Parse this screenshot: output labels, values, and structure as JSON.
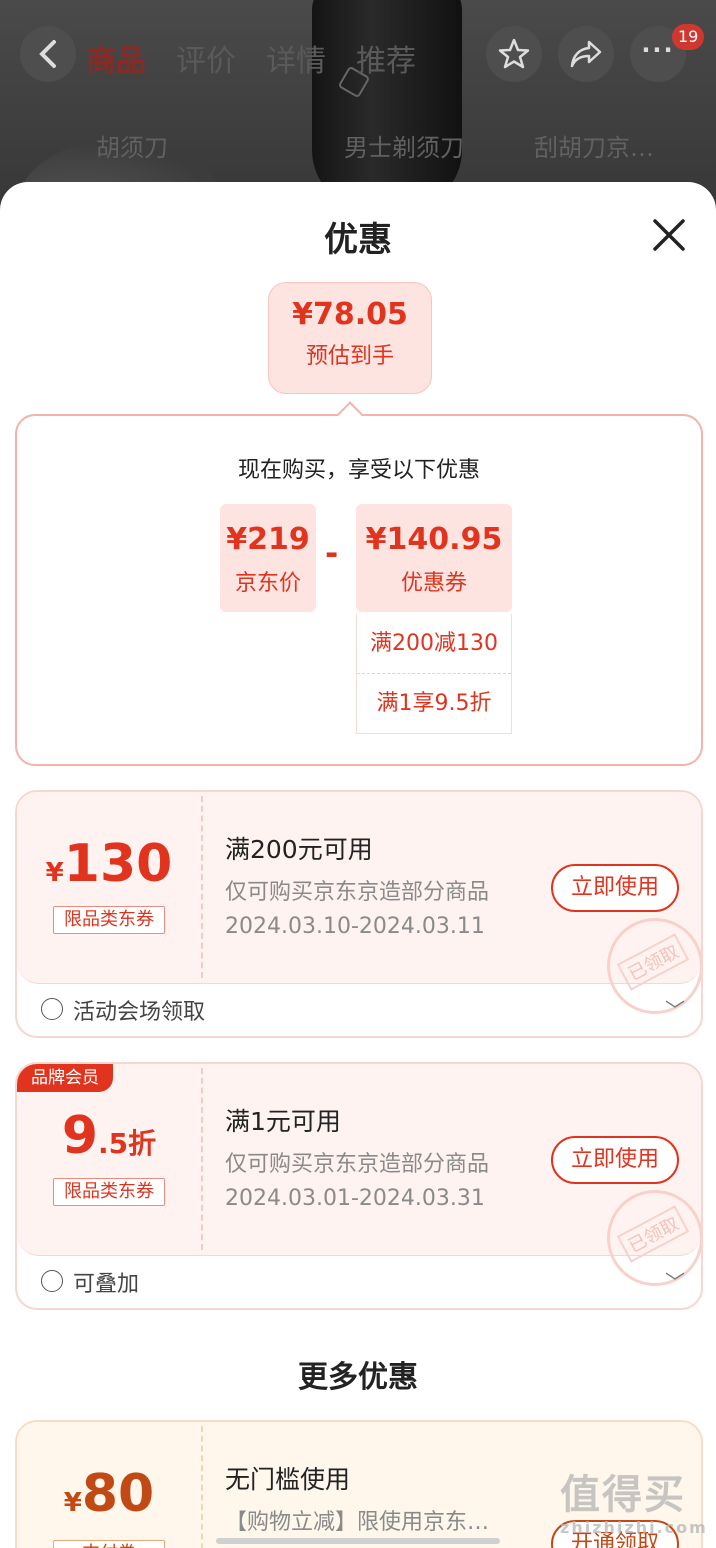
{
  "background": {
    "tabs": [
      "商品",
      "评价",
      "详情",
      "推荐"
    ],
    "search_chips": [
      "胡须刀",
      "男士剃须刀",
      "刮胡刀京…"
    ],
    "cart_badge": "19"
  },
  "sheet": {
    "title": "优惠",
    "estimate": {
      "price": "¥78.05",
      "label": "预估到手"
    },
    "breakdown": {
      "title": "现在购买，享受以下优惠",
      "jd_price": {
        "price": "¥219",
        "label": "京东价"
      },
      "minus": "-",
      "coupon_total": {
        "price": "¥140.95",
        "label": "优惠券"
      },
      "rules": [
        "满200减130",
        "满1享9.5折"
      ]
    },
    "coupons": [
      {
        "yen": "¥",
        "amount": "130",
        "suffix": "",
        "tag": "限品类东券",
        "condition": "满200元可用",
        "scope": "仅可购买京东京造部分商品",
        "date": "2024.03.10-2024.03.11",
        "action": "立即使用",
        "stamp": "已领取",
        "footer": "活动会场领取"
      },
      {
        "badge": "品牌会员",
        "yen": "",
        "amount": "9",
        "suffix": ".5折",
        "tag": "限品类东券",
        "condition": "满1元可用",
        "scope": "仅可购买京东京造部分商品",
        "date": "2024.03.01-2024.03.31",
        "action": "立即使用",
        "stamp": "已领取",
        "footer": "可叠加"
      }
    ],
    "more_title": "更多优惠",
    "more_coupons": [
      {
        "yen": "¥",
        "amount": "80",
        "tag": "支付券",
        "condition": "无门槛使用",
        "scope": "【购物立减】限使用京东…",
        "action": "开通领取"
      }
    ]
  },
  "watermark": {
    "main": "值得买",
    "sub": "zhizhizhi.com"
  },
  "colors": {
    "accent": "#e0341f",
    "coupon_bg": "#fff3f1",
    "more_accent": "#c14a14"
  }
}
